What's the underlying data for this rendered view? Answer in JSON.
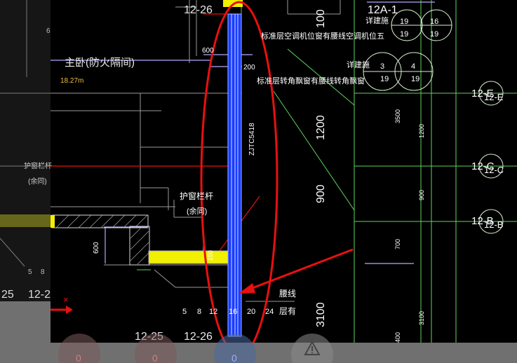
{
  "labels": {
    "grid_12_26_top": "12-26",
    "grid_12a_1": "12A-1",
    "detail_label_1": "详建施",
    "detail_label_2": "详建施",
    "note_ac_unit": "标准层空调机位窗有腰线空调机位五",
    "note_corner_bay": "标准层转角飘窗有腰线转角飘窗",
    "room_name": "主卧(防火隔间)",
    "room_area": "18.27m",
    "dim_600_top": "600",
    "dim_200": "200",
    "window_code": "ZJTC5418",
    "dim_1200": "1200",
    "dim_900": "900",
    "dim_3100": "3100",
    "dim_600_left": "600",
    "dim_150": "150",
    "railing_label": "护窗栏杆",
    "railing_sub": "(余同)",
    "left_railing_label": "护窗栏杆",
    "left_railing_sub": "(余同)",
    "waistline_label": "腰线",
    "floor_label": "层有",
    "scale_5": "5",
    "scale_8": "8",
    "scale_12": "12",
    "scale_16": "16",
    "scale_20": "20",
    "scale_24": "24",
    "grid_12_25_bottom": "12-25",
    "grid_12_26_bottom": "12-26",
    "left_12_25": "25",
    "left_12_2": "12-2",
    "left_5": "5",
    "left_8": "8",
    "grid_12e": "12-E",
    "grid_12e_b": "12-E",
    "grid_12c": "12-C",
    "grid_12c_b": "12-C",
    "grid_12b": "12-B",
    "grid_12b_b": "12-B",
    "bubble_19_a": "19",
    "bubble_19_b": "19",
    "bubble_16": "16",
    "bubble_19_c": "19",
    "bubble_3": "3",
    "bubble_19_d": "19",
    "bubble_4": "4",
    "bubble_19_e": "19",
    "dim_3500": "3500",
    "dim_1200_r": "1200",
    "dim_900_r": "900",
    "dim_700": "700",
    "dim_3100_r": "3100",
    "dim_400": "400",
    "dim_6": "6",
    "status_count_1": "0",
    "status_count_2": "0",
    "status_count_3": "0",
    "warning_icon": "warning-icon"
  },
  "colors": {
    "cad_background": "#000000",
    "window_blue": "#1a3cff",
    "annotation_red": "#e81010",
    "yellow_fill": "#f0f000",
    "grid_green": "#7cff7c",
    "dim_purple": "#b8a8ff"
  }
}
